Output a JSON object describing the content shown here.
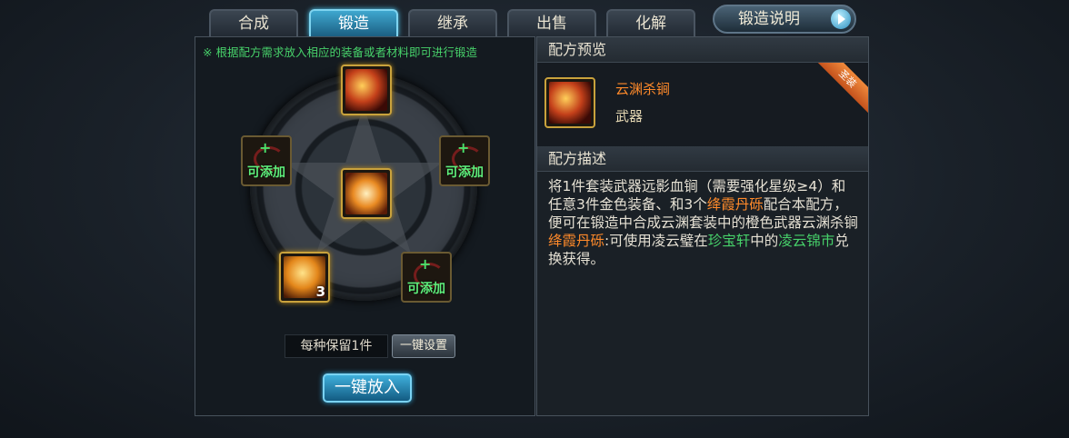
{
  "tabs": [
    {
      "label": "合成",
      "active": false
    },
    {
      "label": "锻造",
      "active": true
    },
    {
      "label": "继承",
      "active": false
    },
    {
      "label": "出售",
      "active": false
    },
    {
      "label": "化解",
      "active": false
    }
  ],
  "help_button": {
    "label": "锻造说明",
    "icon": "play-arrow-icon"
  },
  "forge": {
    "hint": "※ 根据配方需求放入相应的装备或者材料即可进行锻造",
    "slots": [
      {
        "kind": "weapon",
        "label": ""
      },
      {
        "kind": "add",
        "label": "可添加"
      },
      {
        "kind": "add",
        "label": "可添加"
      },
      {
        "kind": "scroll",
        "label": ""
      },
      {
        "kind": "stone",
        "label": "",
        "count": "3"
      },
      {
        "kind": "add",
        "label": "可添加"
      }
    ],
    "keep_label": "每种保留1件",
    "set_button": "一键设置",
    "put_button": "一键放入"
  },
  "preview": {
    "title": "配方预览",
    "item_name": "云渊杀锏",
    "item_type": "武器",
    "ribbon": "圣装"
  },
  "description": {
    "title": "配方描述",
    "parts": [
      {
        "text": "将1件套装武器远影血锏（需要强化星级≥4）和任意3件金色装备、和3个",
        "style": "normal"
      },
      {
        "text": "绛霞丹砾",
        "style": "orange"
      },
      {
        "text": "配合本配方，便可在锻造中合成云渊套装中的橙色武器云渊杀锏",
        "style": "normal"
      },
      {
        "text": "绛霞丹砾",
        "style": "orange",
        "newline": true
      },
      {
        "text": ":可使用凌云璧在",
        "style": "normal"
      },
      {
        "text": "珍宝轩",
        "style": "green"
      },
      {
        "text": "中的",
        "style": "normal"
      },
      {
        "text": "凌云锦市",
        "style": "green"
      },
      {
        "text": "兑换获得。",
        "style": "normal"
      }
    ]
  },
  "colors": {
    "accent": "#3fa7cf",
    "highlight_orange": "#ff8a2a",
    "highlight_green": "#47d16a"
  }
}
